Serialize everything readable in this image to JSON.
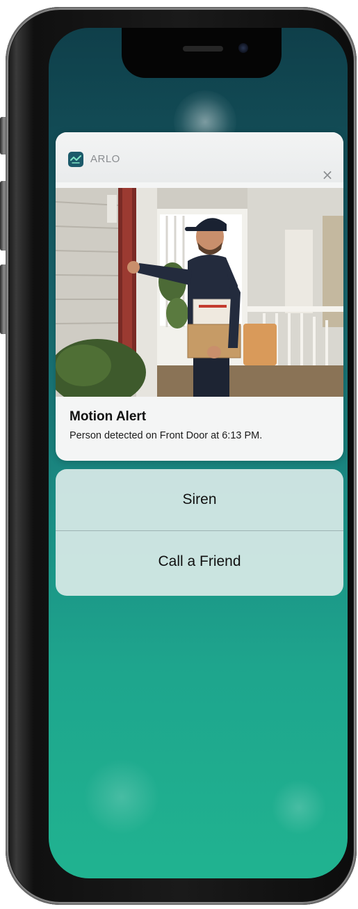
{
  "notification": {
    "app_name": "ARLO",
    "close_glyph": "×",
    "title": "Motion Alert",
    "body": "Person detected on Front Door at 6:13 PM.",
    "app_icon": "arlo-logo-icon",
    "image": "front-door-camera-snapshot"
  },
  "actions": [
    {
      "label": "Siren"
    },
    {
      "label": "Call a Friend"
    }
  ],
  "colors": {
    "wallpaper_top": "#0f3f4a",
    "wallpaper_bottom": "#20b390",
    "app_icon_bg": "#1c5a6a"
  }
}
